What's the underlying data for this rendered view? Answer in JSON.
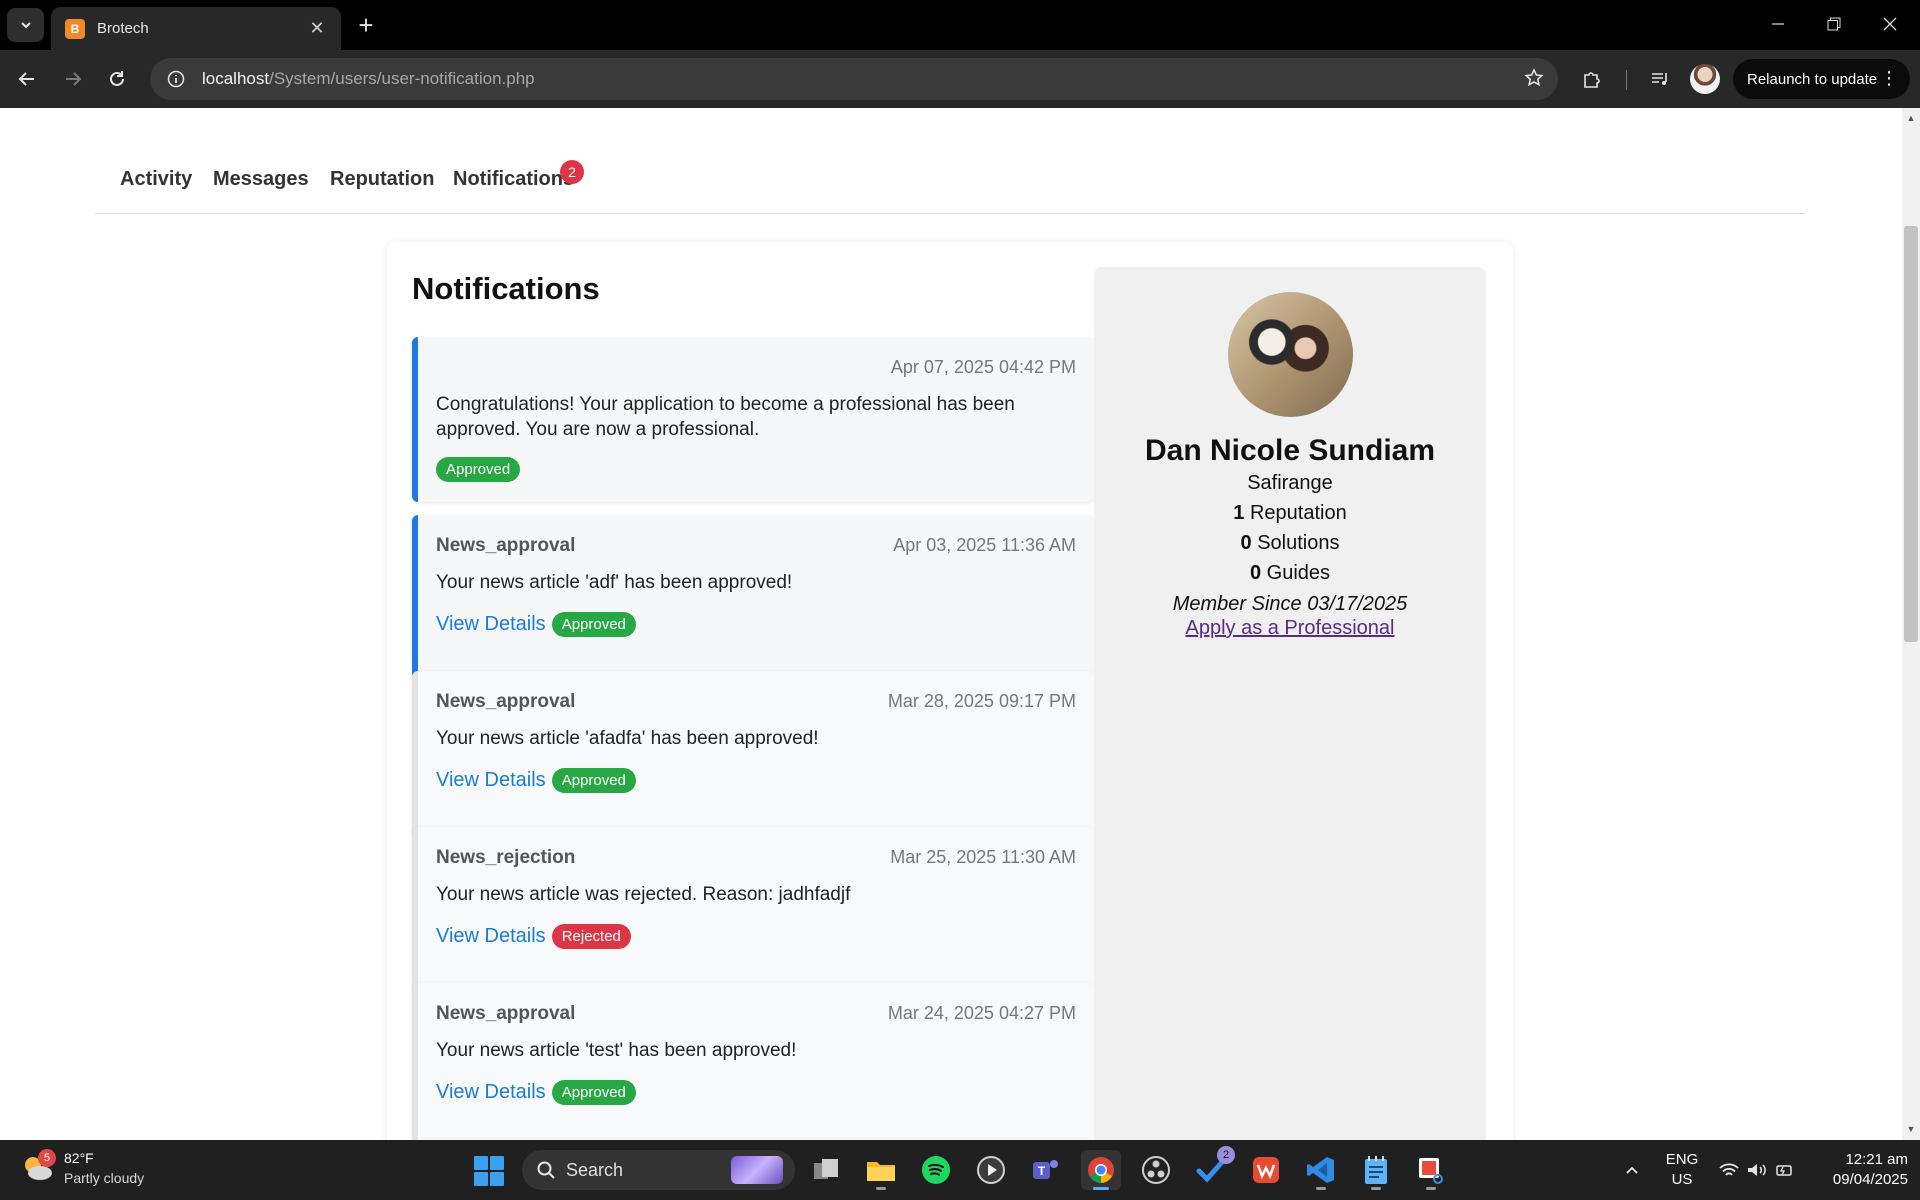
{
  "browser": {
    "tab_title": "Brotech",
    "favicon_letter": "B",
    "url_host": "localhost",
    "url_path": "/System/users/user-notification.php",
    "relaunch_label": "Relaunch to update"
  },
  "profile_tabs": {
    "activity": "Activity",
    "messages": "Messages",
    "reputation": "Reputation",
    "notifications": "Notifications",
    "notifications_count": "2"
  },
  "main": {
    "heading": "Notifications",
    "notifications": [
      {
        "type": "",
        "date": "Apr 07, 2025 04:42 PM",
        "message": "Congratulations! Your application to become a professional has been approved. You are now a professional.",
        "status": "Approved",
        "link": ""
      },
      {
        "type": "News_approval",
        "date": "Apr 03, 2025 11:36 AM",
        "message": "Your news article 'adf' has been approved!",
        "status": "Approved",
        "link": "View Details"
      },
      {
        "type": "News_approval",
        "date": "Mar 28, 2025 09:17 PM",
        "message": "Your news article 'afadfa' has been approved!",
        "status": "Approved",
        "link": "View Details"
      },
      {
        "type": "News_rejection",
        "date": "Mar 25, 2025 11:30 AM",
        "message": "Your news article was rejected. Reason: jadhfadjf",
        "status": "Rejected",
        "link": "View Details"
      },
      {
        "type": "News_approval",
        "date": "Mar 24, 2025 04:27 PM",
        "message": "Your news article 'test' has been approved!",
        "status": "Approved",
        "link": "View Details"
      }
    ]
  },
  "sidebar": {
    "name": "Dan Nicole Sundiam",
    "username": "Safirange",
    "reputation_count": "1",
    "reputation_label": "Reputation",
    "solutions_count": "0",
    "solutions_label": "Solutions",
    "guides_count": "0",
    "guides_label": "Guides",
    "member_since": "Member Since 03/17/2025",
    "apply_link": "Apply as a Professional"
  },
  "taskbar": {
    "temperature": "82°F",
    "weather_desc": "Partly cloudy",
    "weather_badge": "5",
    "search_label": "Search",
    "todo_badge": "2",
    "lang_top": "ENG",
    "lang_bottom": "US",
    "time": "12:21 am",
    "date": "09/04/2025"
  },
  "colors": {
    "accent_blue": "#1e7ae0",
    "approved": "#28a745",
    "rejected": "#dc3545",
    "link": "#1a7bd8"
  }
}
